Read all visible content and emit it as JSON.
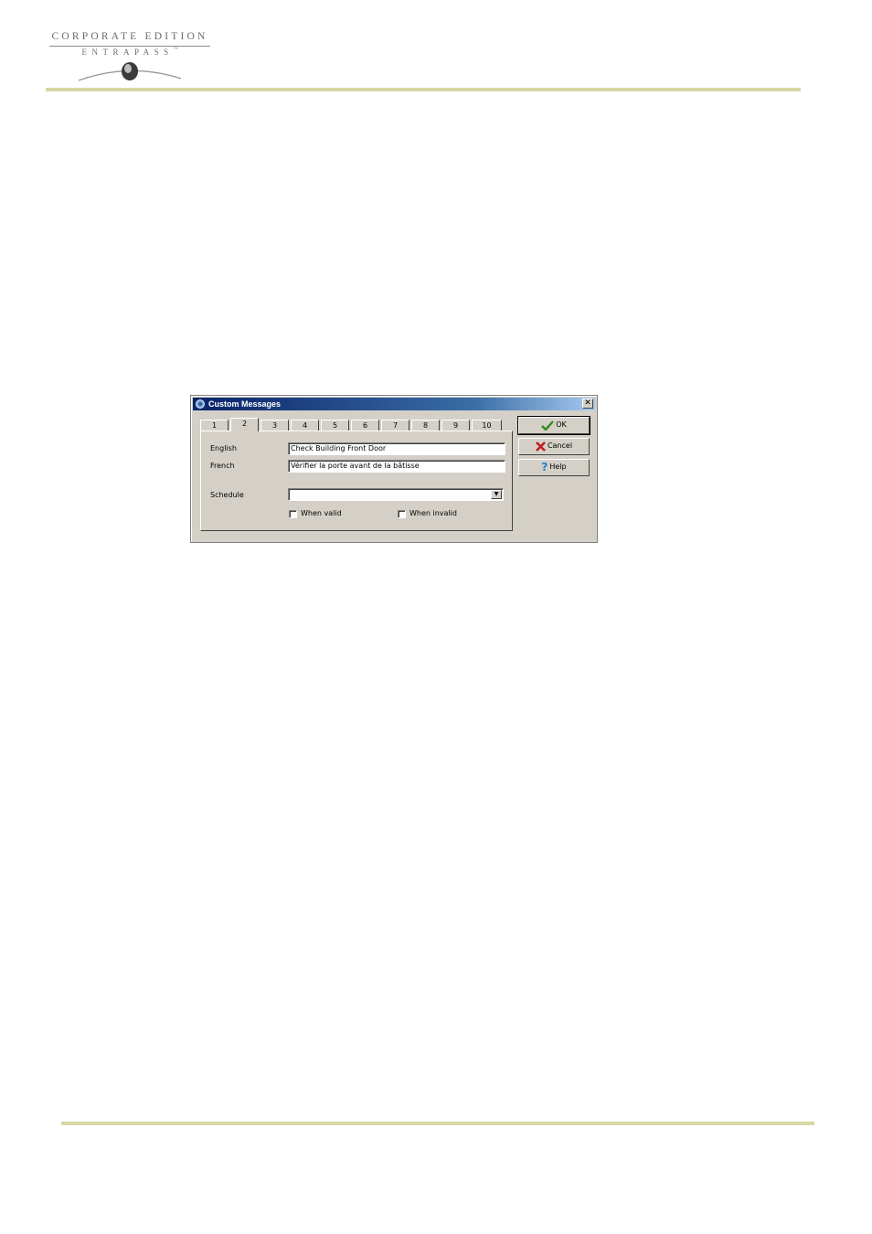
{
  "logo": {
    "line1": "CORPORATE EDITION",
    "line2": "ENTRAPASS",
    "tm": "™"
  },
  "dialog": {
    "title": "Custom Messages",
    "close_glyph": "✕",
    "tabs": [
      "1",
      "2",
      "3",
      "4",
      "5",
      "6",
      "7",
      "8",
      "9",
      "10"
    ],
    "active_tab": "2",
    "fields": {
      "english_label": "English",
      "english_value": "Check Building Front Door",
      "french_label": "French",
      "french_value": "Vérifier la porte avant de la bâtisse",
      "schedule_label": "Schedule",
      "schedule_value": ""
    },
    "checkboxes": {
      "when_valid": "When valid",
      "when_invalid": "When invalid"
    },
    "buttons": {
      "ok": "OK",
      "cancel": "Cancel",
      "help": "Help"
    }
  },
  "colors": {
    "accent_rule": "#d8d8a6",
    "title_bar": "#0a246a",
    "ok_check": "#2e8b1e",
    "cancel_x": "#c01818",
    "help_q": "#1a7fd0"
  }
}
